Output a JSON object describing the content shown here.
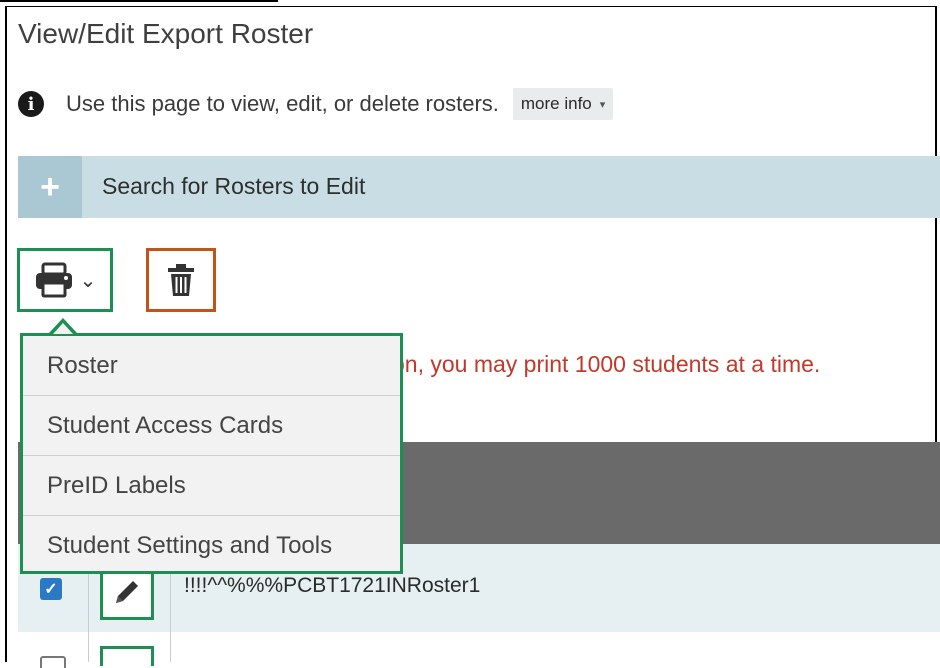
{
  "page": {
    "title": "View/Edit Export Roster",
    "info_text": "Use this page to view, edit, or delete rosters.",
    "more_info_label": "more info"
  },
  "search_panel": {
    "label": "Search for Rosters to Edit"
  },
  "toolbar": {
    "print_icon": "printer-icon",
    "delete_icon": "trash-icon"
  },
  "warning": {
    "text": "on, you may print 1000 students at a time."
  },
  "print_menu": {
    "items": [
      {
        "label": "Roster"
      },
      {
        "label": "Student Access Cards"
      },
      {
        "label": "PreID Labels"
      },
      {
        "label": "Student Settings and Tools"
      }
    ]
  },
  "table": {
    "rows": [
      {
        "name": "!!!!^^%%%PCBT1721INRoster1",
        "selected": true
      }
    ]
  },
  "colors": {
    "accent_green": "#1e8f53",
    "delete_orange": "#c4531a",
    "warning_red": "#c0392b",
    "panel_blue": "#c9dde4",
    "header_gray": "#6a6a6a",
    "checkbox_blue": "#2b78c5"
  }
}
